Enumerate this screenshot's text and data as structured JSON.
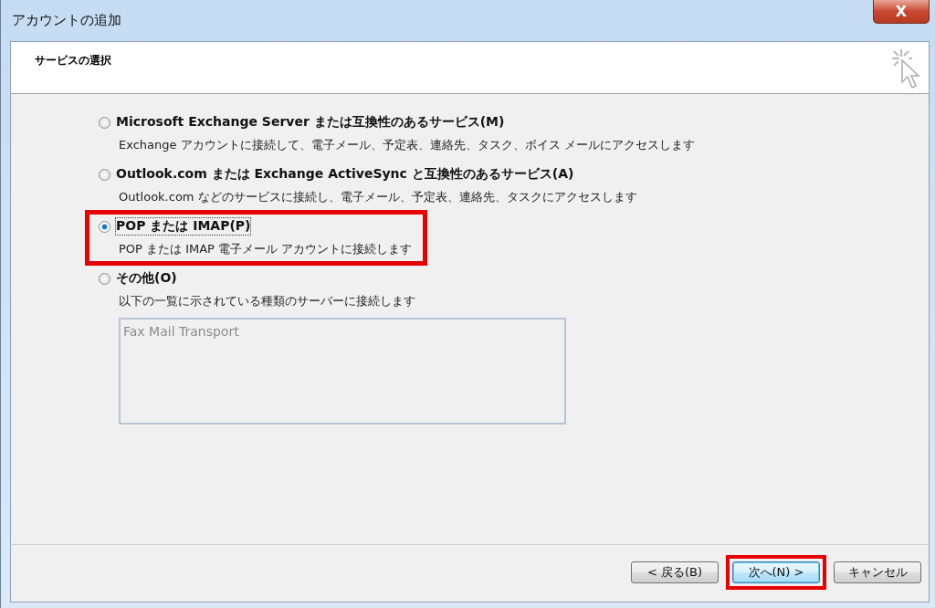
{
  "window": {
    "title": "アカウントの追加",
    "close": "X"
  },
  "header": {
    "title": "サービスの選択"
  },
  "options": [
    {
      "label": "Microsoft Exchange Server または互換性のあるサービス(M)",
      "description": "Exchange アカウントに接続して、電子メール、予定表、連絡先、タスク、ボイス メールにアクセスします",
      "selected": false,
      "highlighted": false
    },
    {
      "label": "Outlook.com または Exchange ActiveSync と互換性のあるサービス(A)",
      "description": "Outlook.com などのサービスに接続し、電子メール、予定表、連絡先、タスクにアクセスします",
      "selected": false,
      "highlighted": false
    },
    {
      "label": "POP または IMAP(P)",
      "description": "POP または IMAP 電子メール アカウントに接続します",
      "selected": true,
      "highlighted": true
    },
    {
      "label": "その他(O)",
      "description": "以下の一覧に示されている種類のサーバーに接続します",
      "selected": false,
      "highlighted": false,
      "list": [
        "Fax Mail Transport"
      ]
    }
  ],
  "buttons": [
    {
      "label": "< 戻る(B)",
      "focused": false,
      "highlighted": false
    },
    {
      "label": "次へ(N) >",
      "focused": true,
      "highlighted": true
    },
    {
      "label": "キャンセル",
      "focused": false,
      "highlighted": false
    }
  ]
}
